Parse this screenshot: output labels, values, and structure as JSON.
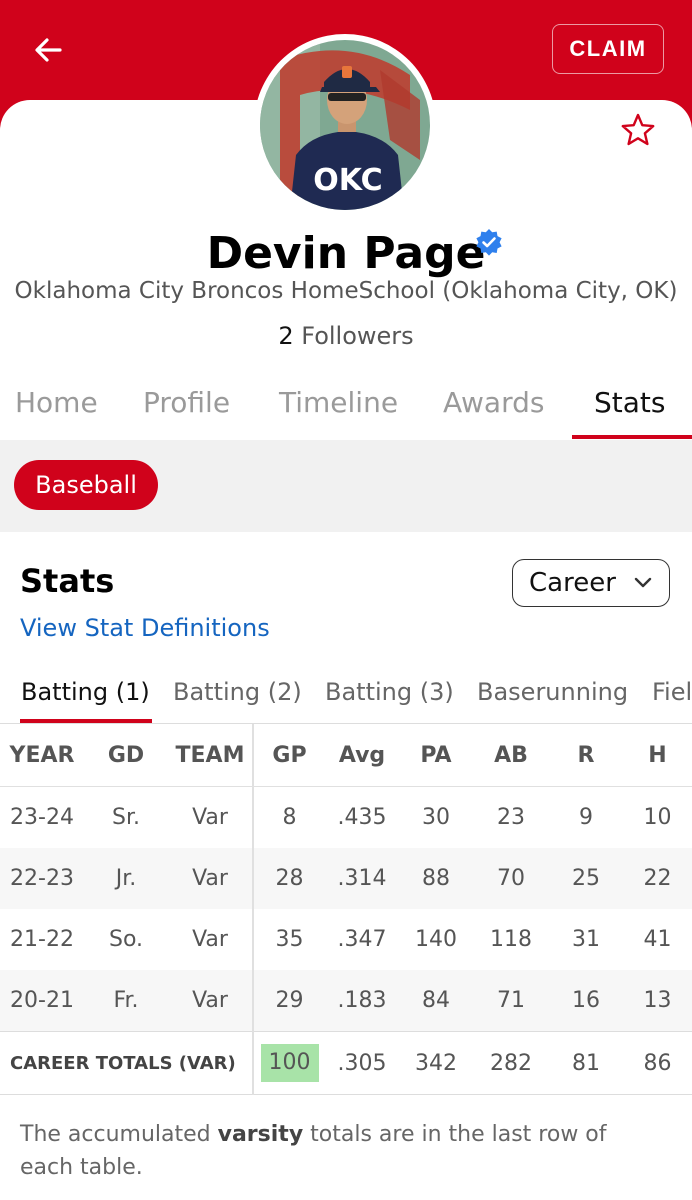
{
  "header": {
    "claim_label": "CLAIM"
  },
  "profile": {
    "name": "Devin Page",
    "school": "Oklahoma City Broncos HomeSchool (Oklahoma City, OK)",
    "followers_count": "2",
    "followers_label": "Followers",
    "jersey_text": "OKC"
  },
  "tabs": [
    {
      "label": "Home"
    },
    {
      "label": "Profile"
    },
    {
      "label": "Timeline"
    },
    {
      "label": "Awards"
    },
    {
      "label": "Stats"
    }
  ],
  "sport": {
    "label": "Baseball"
  },
  "stats": {
    "title": "Stats",
    "period_selected": "Career",
    "definitions_link": "View Stat Definitions",
    "subtabs": [
      {
        "label": "Batting (1)"
      },
      {
        "label": "Batting (2)"
      },
      {
        "label": "Batting (3)"
      },
      {
        "label": "Baserunning"
      },
      {
        "label": "Fiel"
      }
    ],
    "columns": [
      "YEAR",
      "GD",
      "TEAM",
      "GP",
      "Avg",
      "PA",
      "AB",
      "R",
      "H"
    ],
    "rows": [
      [
        "23-24",
        "Sr.",
        "Var",
        "8",
        ".435",
        "30",
        "23",
        "9",
        "10"
      ],
      [
        "22-23",
        "Jr.",
        "Var",
        "28",
        ".314",
        "88",
        "70",
        "25",
        "22"
      ],
      [
        "21-22",
        "So.",
        "Var",
        "35",
        ".347",
        "140",
        "118",
        "31",
        "41"
      ],
      [
        "20-21",
        "Fr.",
        "Var",
        "29",
        ".183",
        "84",
        "71",
        "16",
        "13"
      ]
    ],
    "totals": {
      "label": "CAREER TOTALS (VAR)",
      "values": [
        "100",
        ".305",
        "342",
        "282",
        "81",
        "86"
      ]
    },
    "footnote_pre": "The accumulated ",
    "footnote_bold": "varsity",
    "footnote_post": " totals are in the last row of each table."
  },
  "colors": {
    "brand": "#d0021b",
    "link": "#1565c0",
    "highlight": "#a8e3a8",
    "verified": "#2f80ed"
  },
  "icons": {
    "back": "arrow-left-icon",
    "favorite": "star-outline-icon",
    "verified": "verified-badge-icon",
    "dropdown": "chevron-down-icon"
  }
}
